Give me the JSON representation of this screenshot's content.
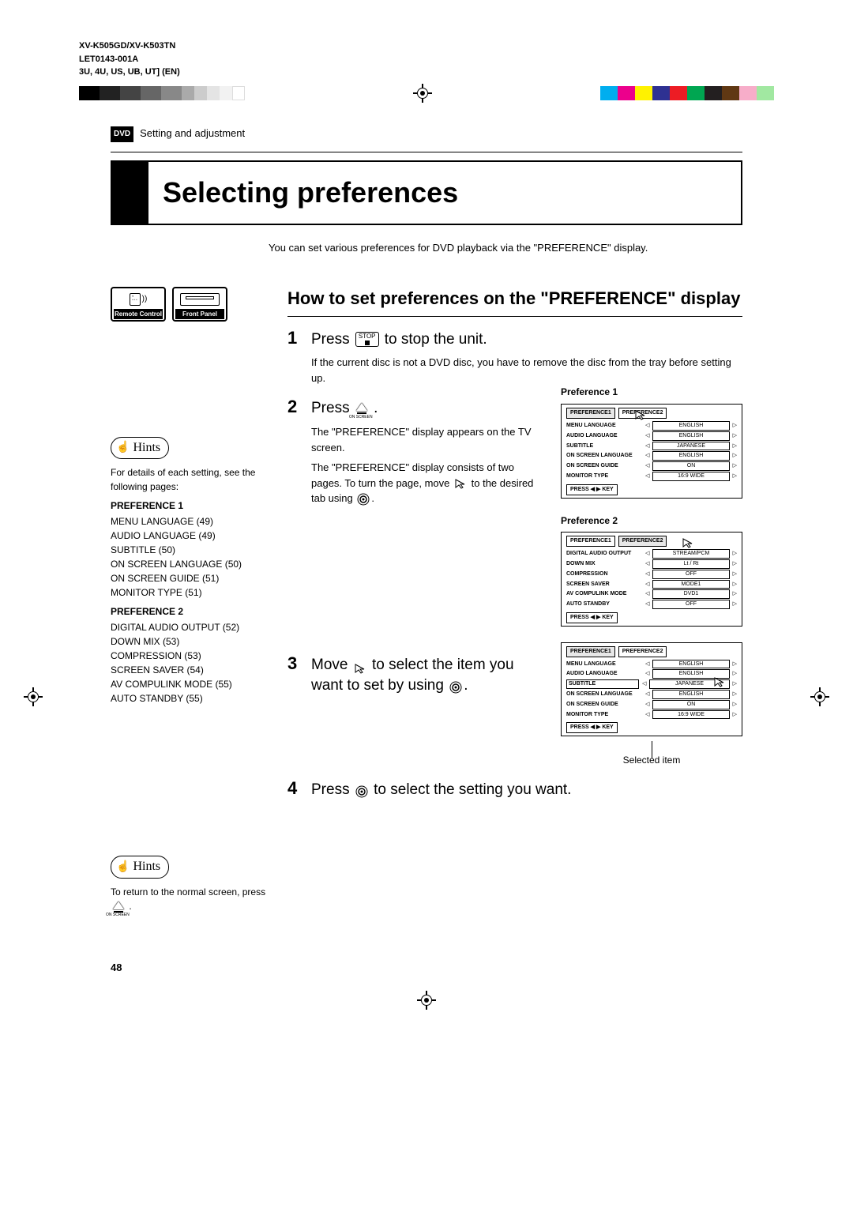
{
  "model_lines": {
    "l1": "XV-K505GD/XV-K503TN",
    "l2": "LET0143-001A",
    "l3": "3U, 4U, US, UB, UT]   (EN)"
  },
  "breadcrumb": {
    "badge": "DVD",
    "text": "Setting and adjustment"
  },
  "title": "Selecting preferences",
  "intro": "You can set various preferences for DVD playback via the \"PREFERENCE\" display.",
  "control_icons": {
    "remote": "Remote Control",
    "front": "Front Panel"
  },
  "hints_label": "Hints",
  "hints1": {
    "intro": "For details of each setting, see the following pages:",
    "p1_head": "PREFERENCE 1",
    "p1_items": [
      "MENU LANGUAGE (49)",
      "AUDIO LANGUAGE (49)",
      "SUBTITLE (50)",
      "ON SCREEN LANGUAGE (50)",
      "ON SCREEN GUIDE (51)",
      "MONITOR TYPE (51)"
    ],
    "p2_head": "PREFERENCE 2",
    "p2_items": [
      "DIGITAL AUDIO OUTPUT (52)",
      "DOWN MIX (53)",
      "COMPRESSION (53)",
      "SCREEN SAVER (54)",
      "AV COMPULINK MODE (55)",
      "AUTO STANDBY (55)"
    ]
  },
  "hints2": {
    "text_a": "To return to the normal screen, press",
    "text_b": "."
  },
  "section_heading": "How to set preferences on the \"PREFERENCE\" display",
  "steps": {
    "s1": {
      "num": "1",
      "title_a": "Press",
      "title_b": "to stop the unit.",
      "body": "If the current disc is not a DVD disc, you have to remove the disc from the tray before setting up."
    },
    "s2": {
      "num": "2",
      "title_a": "Press",
      "title_b": ".",
      "body_a": "The \"PREFERENCE\" display appears on the TV screen.",
      "body_b": "The \"PREFERENCE\" display consists of two pages. To turn the page, move",
      "body_c": "to the desired tab using",
      "body_d": "."
    },
    "s3": {
      "num": "3",
      "title_a": "Move",
      "title_b": "to select the item you want to set by using",
      "title_c": "."
    },
    "s4": {
      "num": "4",
      "title_a": "Press",
      "title_b": "to select the setting you want."
    }
  },
  "osd": {
    "tab1": "PREFERENCE1",
    "tab2": "PREFERENCE2",
    "foot": "PRESS  ◀ ▶  KEY",
    "pref1_label": "Preference 1",
    "pref2_label": "Preference 2",
    "selected_caption": "Selected item",
    "p1_rows": [
      {
        "k": "MENU LANGUAGE",
        "v": "ENGLISH"
      },
      {
        "k": "AUDIO LANGUAGE",
        "v": "ENGLISH"
      },
      {
        "k": "SUBTITLE",
        "v": "JAPANESE"
      },
      {
        "k": "ON SCREEN LANGUAGE",
        "v": "ENGLISH"
      },
      {
        "k": "ON SCREEN GUIDE",
        "v": "ON"
      },
      {
        "k": "MONITOR TYPE",
        "v": "16:9 WIDE"
      }
    ],
    "p2_rows": [
      {
        "k": "DIGITAL AUDIO OUTPUT",
        "v": "STREAM/PCM"
      },
      {
        "k": "DOWN MIX",
        "v": "Lt / Rt"
      },
      {
        "k": "COMPRESSION",
        "v": "OFF"
      },
      {
        "k": "SCREEN SAVER",
        "v": "MODE1"
      },
      {
        "k": "AV COMPULINK MODE",
        "v": "DVD1"
      },
      {
        "k": "AUTO STANDBY",
        "v": "OFF"
      }
    ],
    "p3_rows": [
      {
        "k": "MENU LANGUAGE",
        "v": "ENGLISH"
      },
      {
        "k": "AUDIO LANGUAGE",
        "v": "ENGLISH"
      },
      {
        "k": "SUBTITLE",
        "v": "JAPANESE",
        "sel": true
      },
      {
        "k": "ON SCREEN LANGUAGE",
        "v": "ENGLISH"
      },
      {
        "k": "ON SCREEN GUIDE",
        "v": "ON"
      },
      {
        "k": "MONITOR TYPE",
        "v": "16:9 WIDE"
      }
    ]
  },
  "stop_label": "STOP",
  "onscreen_label": "ON SCREEN",
  "page_num": "48"
}
